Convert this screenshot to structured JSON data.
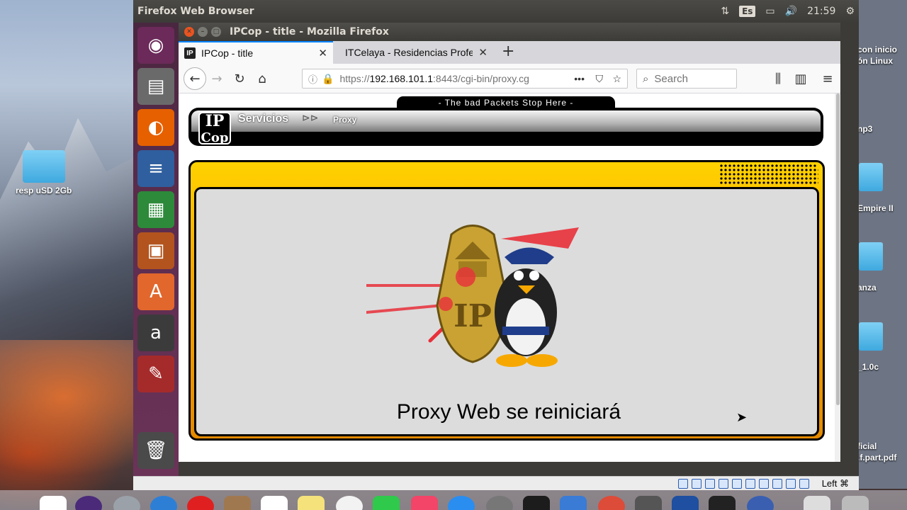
{
  "desktop": {
    "icons": [
      {
        "label": "resp uSD 2Gb"
      }
    ],
    "right_labels": [
      "con inicio",
      "ón Linux",
      "np3",
      "Empire II",
      "anza",
      "_1.0c",
      "ficial",
      ".f.part.pdf"
    ]
  },
  "ubuntu": {
    "topbar_title": "Firefox Web Browser",
    "keyboard_indicator": "Es",
    "clock": "21:59"
  },
  "firefox": {
    "window_title": "IPCop - title - Mozilla Firefox",
    "tabs": [
      {
        "label": "IPCop - title",
        "favicon": "IP"
      },
      {
        "label": "ITCelaya - Residencias Profe"
      }
    ],
    "url_scheme": "https://",
    "url_host": "192.168.101.1",
    "url_rest": ":8443/cgi-bin/proxy.cg",
    "search_placeholder": "Search"
  },
  "page": {
    "slogan": "- The bad Packets Stop Here -",
    "logo_text": "IPCop",
    "nav_section": "Servicios",
    "nav_arrow": "⊳⊳",
    "nav_current": "Proxy",
    "message": "Proxy Web se reiniciará"
  },
  "vm_status": {
    "host_key": "Left ⌘"
  },
  "colors": {
    "frame_gold": "#f7a800",
    "panel_gray": "#dcdcdc",
    "launcher_purple": "#5b2c4d"
  }
}
